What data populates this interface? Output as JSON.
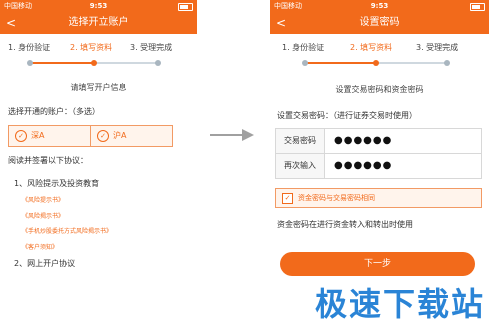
{
  "left": {
    "status": {
      "carrier": "中国移动",
      "time": "9:53"
    },
    "nav": {
      "back": "<",
      "title": "选择开立账户"
    },
    "steps": [
      "1. 身份验证",
      "2. 填写资料",
      "3. 受理完成"
    ],
    "subtitle": "请填写开户信息",
    "select_label": "选择开通的账户：（多选）",
    "markets": [
      {
        "label": "深A"
      },
      {
        "label": "沪A"
      }
    ],
    "read_label": "阅读并签署以下协议：",
    "section1": "1、风险提示及投资教育",
    "agreements": [
      "《风险提示书》",
      "《风险揭示书》",
      "《手机炒股委托方式风险揭示书》",
      "《客户须知》"
    ],
    "section2": "2、网上开户协议"
  },
  "right": {
    "status": {
      "carrier": "中国移动",
      "time": "9:53"
    },
    "nav": {
      "back": "<",
      "title": "设置密码"
    },
    "steps": [
      "1. 身份验证",
      "2. 填写资料",
      "3. 受理完成"
    ],
    "subtitle": "设置交易密码和资金密码",
    "trade_label": "设置交易密码：（进行证券交易时使用）",
    "fields": [
      {
        "label": "交易密码",
        "value": "●●●●●●"
      },
      {
        "label": "再次输入",
        "value": "●●●●●●"
      }
    ],
    "same_checkbox": "资金密码与交易密码相同",
    "fund_note": "资金密码在进行资金转入和转出时使用",
    "next_button": "下一步"
  },
  "watermark": "极速下载站",
  "colors": {
    "accent": "#f26a1b",
    "watermark": "#2a84d6"
  }
}
